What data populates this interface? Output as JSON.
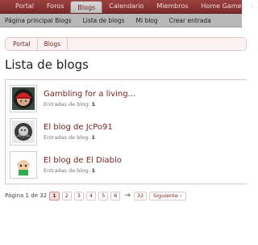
{
  "topnav": {
    "tabs": [
      {
        "label": "Portal",
        "active": false
      },
      {
        "label": "Foros",
        "active": false
      },
      {
        "label": "Blogs",
        "active": true
      },
      {
        "label": "Calendario",
        "active": false
      },
      {
        "label": "Miembros",
        "active": false
      },
      {
        "label": "Home Games - L",
        "active": false
      }
    ]
  },
  "subnav": {
    "items": [
      "Página principal Blogs",
      "Lista de blogs",
      "Mi blog",
      "Crear entrada"
    ]
  },
  "breadcrumb": [
    "Portal",
    "Blogs"
  ],
  "page_title": "Lista de blogs",
  "blogs": [
    {
      "title": "Gambling for a living...",
      "meta_label": "Entradas de blog:",
      "count": "1",
      "avatar": "red-cap-player-avatar"
    },
    {
      "title": "El blog de JcPo91",
      "meta_label": "Entradas de blog:",
      "count": "1",
      "avatar": "masked-figure-avatar"
    },
    {
      "title": "El blog de El Diablo",
      "meta_label": "Entradas de blog:",
      "count": "1",
      "avatar": "cartoon-kid-avatar"
    }
  ],
  "pagination": {
    "label": "Página 1 de 32",
    "pages": [
      "1",
      "2",
      "3",
      "4",
      "5",
      "6"
    ],
    "current": "1",
    "arrow": "→",
    "last": "32",
    "next_label": "Siguiente ›"
  }
}
